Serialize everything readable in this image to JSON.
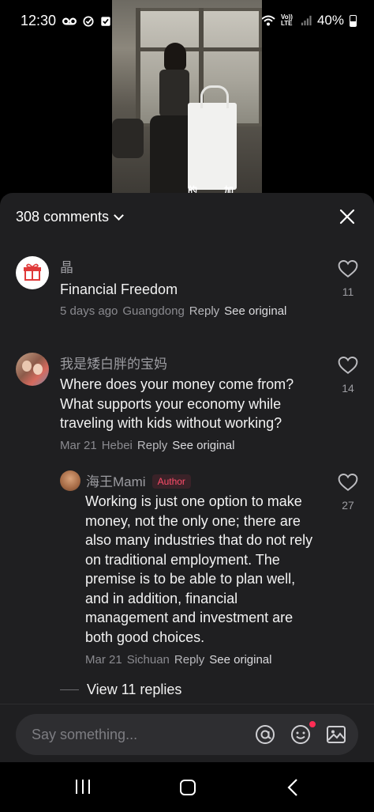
{
  "status_bar": {
    "time": "12:30",
    "battery": "40%",
    "volte": "Vo)) LTE"
  },
  "video": {
    "subtitle_left": "的",
    "subtitle_right": "加"
  },
  "comments_header": {
    "count_label": "308 comments"
  },
  "comments": [
    {
      "name": "晶",
      "text": "Financial Freedom",
      "time": "5 days ago",
      "location": "Guangdong",
      "reply_label": "Reply",
      "see_original_label": "See original",
      "likes": "11"
    },
    {
      "name": "我是矮白胖的宝妈",
      "text": "Where does your money come from? What supports your economy while traveling with kids without working?",
      "time": "Mar 21",
      "location": "Hebei",
      "reply_label": "Reply",
      "see_original_label": "See original",
      "likes": "14"
    }
  ],
  "reply": {
    "name": "海王Mami",
    "badge": "Author",
    "text": "Working is just one option to make money, not the only one; there are also many industries that do not rely on traditional employment. The premise is to be able to plan well, and in addition, financial management and investment are both good choices.",
    "time": "Mar 21",
    "location": "Sichuan",
    "reply_label": "Reply",
    "see_original_label": "See original",
    "likes": "27"
  },
  "view_replies_label": "View 11 replies",
  "input": {
    "placeholder": "Say something..."
  },
  "colors": {
    "sheet_bg": "#1f1f21",
    "author_badge": "#ff4d6a",
    "notification_dot": "#ff2d55"
  },
  "icons": [
    "voicemail-icon",
    "check-circle-icon",
    "checkbox-icon",
    "battery-saver-icon",
    "alarm-icon",
    "mute-icon",
    "wifi-icon",
    "signal-icon",
    "gift-icon",
    "heart-icon",
    "chevron-down-icon",
    "close-icon",
    "at-icon",
    "emoji-icon",
    "image-icon",
    "recents-icon",
    "home-icon",
    "back-icon"
  ]
}
